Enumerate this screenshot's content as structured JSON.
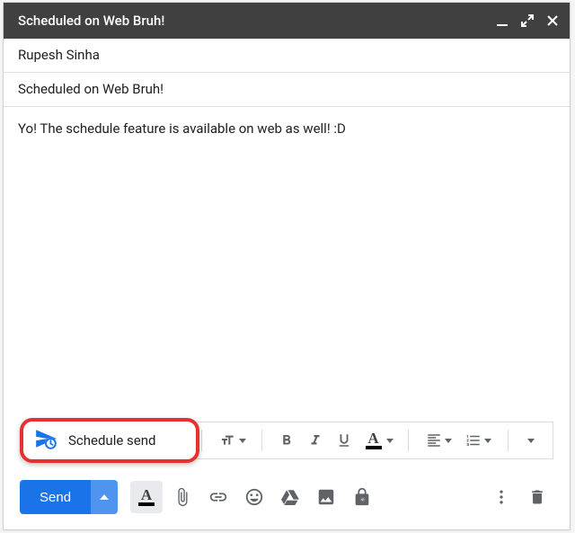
{
  "header": {
    "title": "Scheduled on Web Bruh!"
  },
  "recipient": "Rupesh Sinha",
  "subject": "Scheduled on Web Bruh!",
  "body": "Yo! The schedule feature is available on web as well! :D",
  "popup": {
    "schedule_send_label": "Schedule send"
  },
  "toolbar": {
    "send_label": "Send"
  }
}
